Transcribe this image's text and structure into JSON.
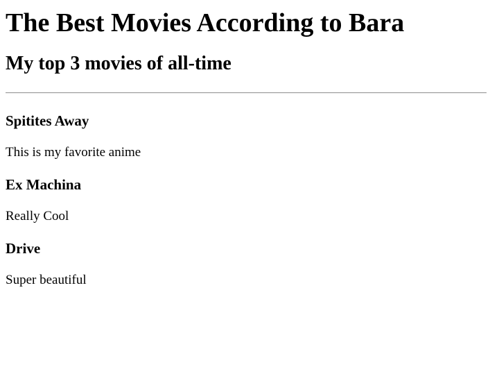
{
  "page": {
    "title": "The Best Movies According to Bara",
    "subtitle": "My top 3 movies of all-time"
  },
  "movies": [
    {
      "title": "Spitites Away",
      "description": "This is my favorite anime"
    },
    {
      "title": "Ex Machina",
      "description": "Really Cool"
    },
    {
      "title": "Drive",
      "description": "Super beautiful"
    }
  ]
}
